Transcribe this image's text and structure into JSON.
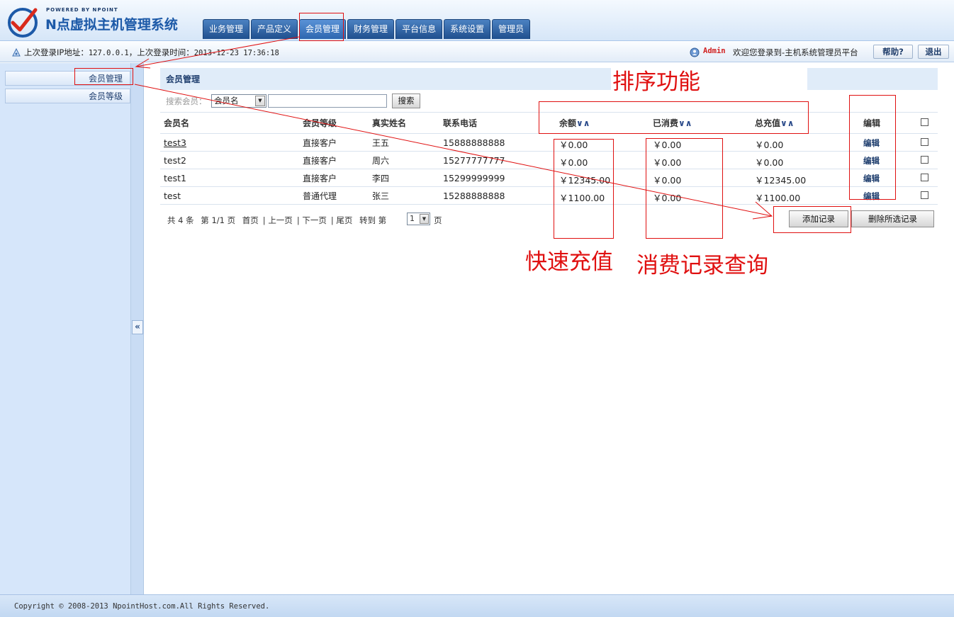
{
  "logo": {
    "powered": "POWERED BY NPOINT",
    "title": "N点虚拟主机管理系统"
  },
  "nav": {
    "tabs": [
      "业务管理",
      "产品定义",
      "会员管理",
      "财务管理",
      "平台信息",
      "系统设置",
      "管理员"
    ],
    "active_index": 2
  },
  "status": {
    "login_ip_label": "上次登录IP地址：",
    "login_ip": "127.0.0.1",
    "login_time_label": "，上次登录时间：",
    "login_time": "2013-12-23 17:36:18",
    "admin_name": "Admin",
    "welcome": "欢迎您登录到-主机系统管理员平台",
    "help_label": "帮助?",
    "logout_label": "退出"
  },
  "sidebar": {
    "items": [
      "会员管理",
      "会员等级"
    ],
    "collapse": "«"
  },
  "main": {
    "title": "会员管理",
    "search_label": "搜索会员：",
    "search_field": "会员名",
    "search_value": "",
    "search_button": "搜索",
    "columns": {
      "name": "会员名",
      "level": "会员等级",
      "real_name": "真实姓名",
      "phone": "联系电话",
      "balance": "余额",
      "consumed": "已消费",
      "recharged": "总充值",
      "edit": "编辑",
      "sort": "∨∧"
    },
    "rows": [
      {
        "name": "test3",
        "level": "直接客户",
        "real_name": "王五",
        "phone": "15888888888",
        "balance": "￥0.00",
        "consumed": "￥0.00",
        "recharged": "￥0.00",
        "edit": "编辑"
      },
      {
        "name": "test2",
        "level": "直接客户",
        "real_name": "周六",
        "phone": "15277777777",
        "balance": "￥0.00",
        "consumed": "￥0.00",
        "recharged": "￥0.00",
        "edit": "编辑"
      },
      {
        "name": "test1",
        "level": "直接客户",
        "real_name": "李四",
        "phone": "15299999999",
        "balance": "￥12345.00",
        "consumed": "￥0.00",
        "recharged": "￥12345.00",
        "edit": "编辑"
      },
      {
        "name": "test",
        "level": "普通代理",
        "real_name": "张三",
        "phone": "15288888888",
        "balance": "￥1100.00",
        "consumed": "￥0.00",
        "recharged": "￥1100.00",
        "edit": "编辑"
      }
    ],
    "pager": {
      "total": "共 4 条",
      "page_info": "第 1/1 页",
      "first": "首页",
      "prev": "上一页",
      "next": "下一页",
      "last": "尾页",
      "goto": "转到 第",
      "page_value": "1",
      "suffix": "页"
    },
    "add_button": "添加记录",
    "delete_button": "删除所选记录"
  },
  "annotations": {
    "sort": "排序功能",
    "recharge": "快速充值",
    "consume": "消费记录查询",
    "color": "#e01010"
  },
  "footer": {
    "copyright": "Copyright © 2008-2013 NpointHost.com.All Rights Reserved."
  }
}
